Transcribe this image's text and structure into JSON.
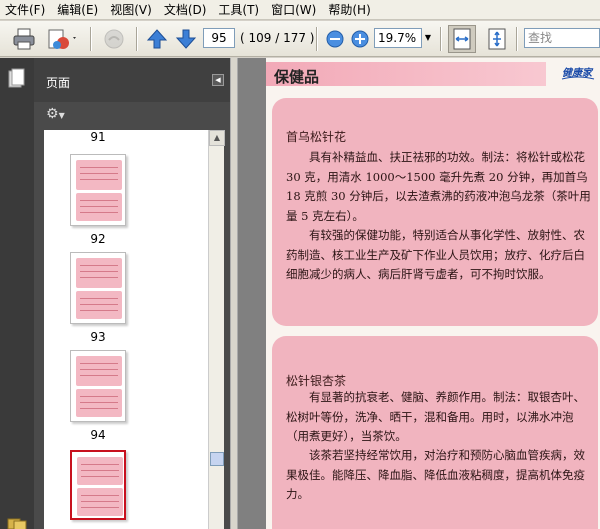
{
  "menu": {
    "items": [
      "文件(F)",
      "编辑(E)",
      "视图(V)",
      "文档(D)",
      "工具(T)",
      "窗口(W)",
      "帮助(H)"
    ]
  },
  "toolbar": {
    "page_number": "95",
    "page_count": "( 109 / 177 )",
    "zoom": "19.7%",
    "search_placeholder": "查找"
  },
  "panel": {
    "title": "页面",
    "thumbnails": [
      {
        "label": "91"
      },
      {
        "label": "92"
      },
      {
        "label": "93"
      },
      {
        "label": "94"
      },
      {
        "label": ""
      }
    ]
  },
  "document": {
    "heading": "保健品",
    "logo_text": "健康家",
    "card1": {
      "title": "首乌松针花",
      "p1": "具有补精益血、扶正祛邪的功效。制法：将松针或松花 30 克，用清水 1000～1500 毫升先煮 20 分钟，再加首乌 18 克煎 30 分钟后，以去渣煮沸的药液冲泡乌龙茶（茶叶用量 5 克左右）。",
      "p2": "有较强的保健功能，特别适合从事化学性、放射性、农药制造、核工业生产及矿下作业人员饮用；放疗、化疗后白细胞减少的病人、病后肝肾亏虚者，可不拘时饮服。"
    },
    "card2": {
      "title": "松针银杏茶",
      "p1": "有显著的抗衰老、健脑、养颜作用。制法：取银杏叶、松树叶等份，洗净、晒干，混和备用。用时，以沸水冲泡（用煮更好），当茶饮。",
      "p2": "该茶若坚持经常饮用，对治疗和预防心脑血管疾病，效果极佳。能降压、降血脂、降低血液粘稠度，提高机体免疫力。"
    }
  },
  "colors": {
    "card_pink": "#f1b4bf",
    "heading_band": "#f2a9b7",
    "panel_dark": "#4a4a4a",
    "selected_border": "#c8101e"
  }
}
